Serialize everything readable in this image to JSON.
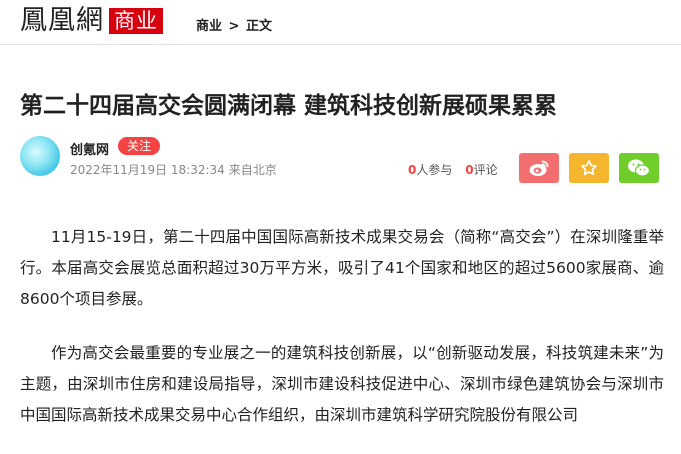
{
  "header": {
    "logo_text": "鳳凰網",
    "logo_badge": "商业",
    "breadcrumb": [
      "商业",
      ">",
      "正文"
    ]
  },
  "article": {
    "title": "第二十四届高交会圆满闭幕 建筑科技创新展硕果累累",
    "author": "创氪网",
    "follow_label": "关注",
    "date": "2022年11月19日 18:32:34",
    "source": "来自北京",
    "participants_count": "0",
    "participants_label": "人参与",
    "comments_count": "0",
    "comments_label": "评论",
    "paragraphs": [
      "11月15-19日，第二十四届中国国际高新技术成果交易会（简称“高交会”）在深圳隆重举行。本届高交会展览总面积超过30万平方米，吸引了41个国家和地区的超过5600家展商、逾8600个项目参展。",
      "作为高交会最重要的专业展之一的建筑科技创新展，以“创新驱动发展，科技筑建未来”为主题，由深圳市住房和建设局指导，深圳市建设科技促进中心、深圳市绿色建筑协会与深圳市中国国际高新技术成果交易中心合作组织，由深圳市建筑科学研究院股份有限公司"
    ]
  },
  "share": {
    "icons": [
      "weibo-icon",
      "star-icon",
      "wechat-icon"
    ],
    "colors": {
      "weibo": "#f36f6f",
      "star": "#f6b52f",
      "wechat": "#6fce2a"
    }
  },
  "colors": {
    "brand_red": "#d7000f",
    "follow_red": "#f54343",
    "meta_gray": "#888888"
  }
}
